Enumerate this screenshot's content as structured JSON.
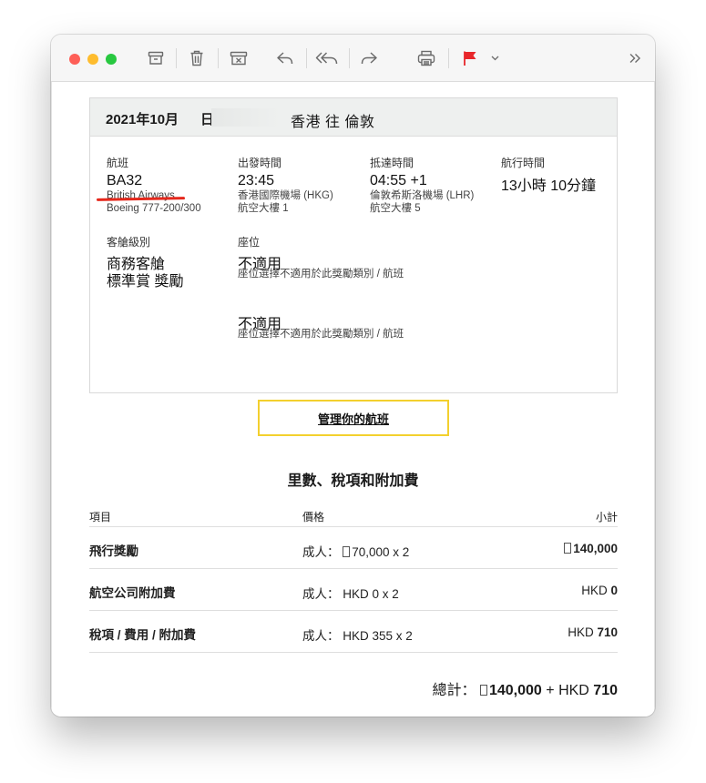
{
  "toolbar": {
    "traffic_lights": [
      "#fe5f57",
      "#febc2e",
      "#28c840"
    ],
    "flag_color": "#e8262a",
    "icons": [
      "archive-icon",
      "trash-icon",
      "junk-icon",
      "reply-icon",
      "reply-all-icon",
      "forward-icon",
      "print-icon",
      "flag-icon",
      "chevron-down-icon",
      "more-icon"
    ]
  },
  "flight": {
    "date": "2021年10月",
    "day_prefix": "日",
    "route": "香港 往 倫敦",
    "flight_label": "航班",
    "flight_number": "BA32",
    "airline": "British Airways",
    "aircraft": "Boeing 777-200/300",
    "depart_label": "出發時間",
    "depart_time": "23:45",
    "depart_airport": "香港國際機場 (HKG)",
    "depart_terminal": "航空大樓 1",
    "arrive_label": "抵達時間",
    "arrive_time": "04:55 +1",
    "arrive_airport": "倫敦希斯洛機場 (LHR)",
    "arrive_terminal": "航空大樓 5",
    "duration_label": "航行時間",
    "duration": "13小時 10分鐘",
    "cabin_label": "客艙級別",
    "cabin_class": "商務客艙",
    "fare_type": "標準賞 獎勵",
    "seat_label": "座位",
    "seat_1": "不適用",
    "seat_1_note": "座位選擇不適用於此獎勵類別 / 航班",
    "seat_2": "不適用",
    "seat_2_note": "座位選擇不適用於此獎勵類別 / 航班",
    "manage_button": "管理你的航班"
  },
  "fees": {
    "title": "里數、稅項和附加費",
    "headers": {
      "item": "項目",
      "price": "價格",
      "subtotal": "小計"
    },
    "rows": [
      {
        "item": "飛行獎勵",
        "price_prefix": "成人：",
        "price_value": "70,000 x 2",
        "subtotal_prefix": "",
        "subtotal_value": "140,000",
        "miles": true
      },
      {
        "item": "航空公司附加費",
        "price_prefix": "成人：",
        "price_value": "HKD 0 x 2",
        "subtotal_prefix": "HKD ",
        "subtotal_value": "0",
        "miles": false
      },
      {
        "item": "稅項 / 費用 / 附加費",
        "price_prefix": "成人：",
        "price_value": "HKD 355 x 2",
        "subtotal_prefix": "HKD ",
        "subtotal_value": "710",
        "miles": false
      }
    ],
    "total_label": "總計：",
    "total_miles": "140,000",
    "total_plus": " + HKD ",
    "total_hkd": "710"
  }
}
